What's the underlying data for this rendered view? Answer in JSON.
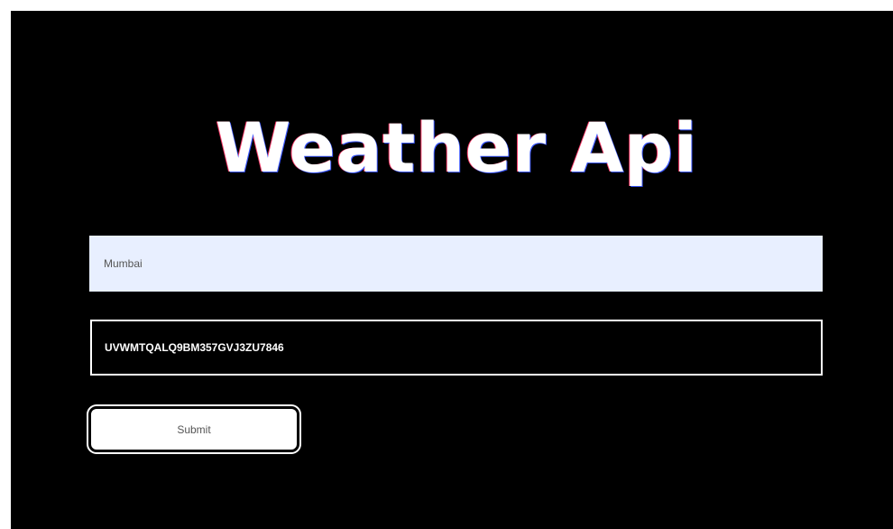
{
  "app": {
    "title": "Weather Api"
  },
  "form": {
    "city_field": {
      "value": "",
      "placeholder": "Mumbai"
    },
    "api_key_field": {
      "value": "UVWMTQALQ9BM357GVJ3ZU7846",
      "placeholder": ""
    },
    "submit_label": "Submit"
  },
  "colors": {
    "background": "#000000",
    "city_field_bg": "#e8efff",
    "text": "#ffffff"
  }
}
